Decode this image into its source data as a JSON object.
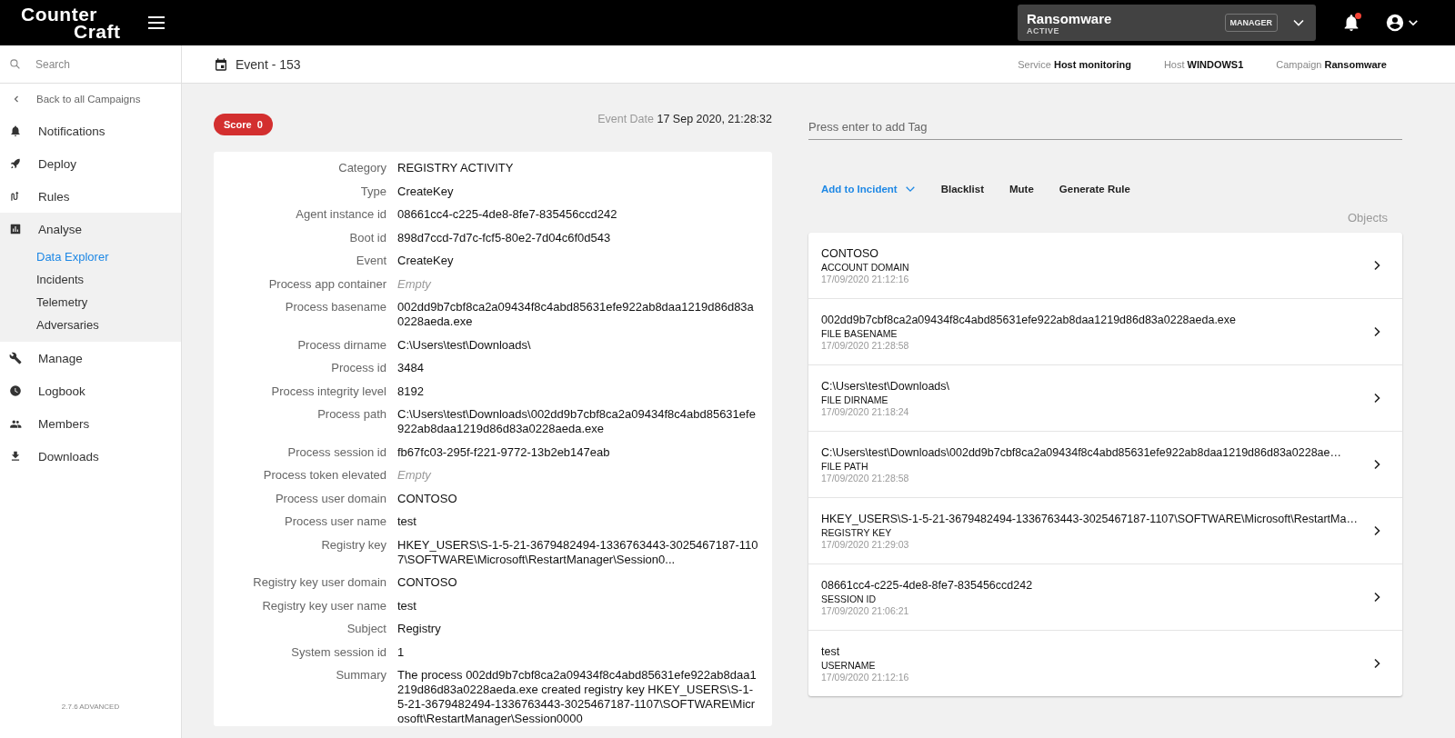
{
  "topbar": {
    "logo_line1": "Counter",
    "logo_line2": "Craft",
    "campaign": {
      "name": "Ransomware",
      "status": "ACTIVE",
      "role": "MANAGER"
    },
    "notifications_unread": true
  },
  "sidebar": {
    "search": {
      "placeholder": "Search"
    },
    "back": "Back to all Campaigns",
    "items": [
      {
        "label": "Notifications",
        "expanded": false
      },
      {
        "label": "Deploy",
        "expanded": false
      },
      {
        "label": "Rules",
        "expanded": false
      },
      {
        "label": "Analyse",
        "expanded": true,
        "children": [
          {
            "label": "Data Explorer",
            "selected": true
          },
          {
            "label": "Incidents",
            "selected": false
          },
          {
            "label": "Telemetry",
            "selected": false
          },
          {
            "label": "Adversaries",
            "selected": false
          }
        ]
      },
      {
        "label": "Manage",
        "expanded": false
      },
      {
        "label": "Logbook",
        "expanded": false
      },
      {
        "label": "Members",
        "expanded": false
      },
      {
        "label": "Downloads",
        "expanded": false
      }
    ],
    "version": "2.7.6 ADVANCED"
  },
  "header": {
    "title": "Event - 153",
    "meta": [
      {
        "label": "Service",
        "value": "Host monitoring"
      },
      {
        "label": "Host",
        "value": "WINDOWS1"
      },
      {
        "label": "Campaign",
        "value": "Ransomware"
      }
    ]
  },
  "event": {
    "score_label": "Score",
    "score": "0",
    "date_label": "Event Date",
    "date": "17 Sep 2020, 21:28:32",
    "fields": [
      {
        "label": "Category",
        "value": "REGISTRY ACTIVITY",
        "kind": "text"
      },
      {
        "label": "Type",
        "value": "CreateKey",
        "kind": "text"
      },
      {
        "label": "Agent instance id",
        "value": "08661cc4-c225-4de8-8fe7-835456ccd242",
        "kind": "text"
      },
      {
        "label": "Boot id",
        "value": "898d7ccd-7d7c-fcf5-80e2-7d04c6f0d543",
        "kind": "text"
      },
      {
        "label": "Event",
        "value": "CreateKey",
        "kind": "text"
      },
      {
        "label": "Process app container",
        "value": "Empty",
        "kind": "empty"
      },
      {
        "label": "Process basename",
        "value": "002dd9b7cbf8ca2a09434f8c4abd85631efe922ab8daa1219d86d83a0228aeda.exe",
        "kind": "text"
      },
      {
        "label": "Process dirname",
        "value": "C:\\Users\\test\\Downloads\\",
        "kind": "text"
      },
      {
        "label": "Process id",
        "value": "3484",
        "kind": "text"
      },
      {
        "label": "Process integrity level",
        "value": "8192",
        "kind": "text"
      },
      {
        "label": "Process path",
        "value": "C:\\Users\\test\\Downloads\\002dd9b7cbf8ca2a09434f8c4abd85631efe922ab8daa1219d86d83a0228aeda.exe",
        "kind": "text"
      },
      {
        "label": "Process session id",
        "value": "fb67fc03-295f-f221-9772-13b2eb147eab",
        "kind": "text"
      },
      {
        "label": "Process token elevated",
        "value": "Empty",
        "kind": "empty"
      },
      {
        "label": "Process user domain",
        "value": "CONTOSO",
        "kind": "text"
      },
      {
        "label": "Process user name",
        "value": "test",
        "kind": "text"
      },
      {
        "label": "Registry key",
        "value": "HKEY_USERS\\S-1-5-21-3679482494-1336763443-3025467187-1107\\SOFTWARE\\Microsoft\\RestartManager\\Session0...",
        "kind": "text"
      },
      {
        "label": "Registry key user domain",
        "value": "CONTOSO",
        "kind": "text"
      },
      {
        "label": "Registry key user name",
        "value": "test",
        "kind": "text"
      },
      {
        "label": "Subject",
        "value": "Registry",
        "kind": "text"
      },
      {
        "label": "System session id",
        "value": "1",
        "kind": "text"
      },
      {
        "label": "Summary",
        "value": "The process 002dd9b7cbf8ca2a09434f8c4abd85631efe922ab8daa1219d86d83a0228aeda.exe created registry key HKEY_USERS\\S-1-5-21-3679482494-1336763443-3025467187-1107\\SOFTWARE\\Microsoft\\RestartManager\\Session0000",
        "kind": "text"
      }
    ]
  },
  "tags": {
    "placeholder": "Press enter to add Tag"
  },
  "actions": [
    {
      "label": "Add to Incident",
      "kind": "dropdown"
    },
    {
      "label": "Blacklist",
      "kind": "plain"
    },
    {
      "label": "Mute",
      "kind": "plain"
    },
    {
      "label": "Generate Rule",
      "kind": "plain"
    }
  ],
  "objects": {
    "title": "Objects",
    "items": [
      {
        "value": "CONTOSO",
        "type": "ACCOUNT DOMAIN",
        "time": "17/09/2020 21:12:16"
      },
      {
        "value": "002dd9b7cbf8ca2a09434f8c4abd85631efe922ab8daa1219d86d83a0228aeda.exe",
        "type": "FILE BASENAME",
        "time": "17/09/2020 21:28:58"
      },
      {
        "value": "C:\\Users\\test\\Downloads\\",
        "type": "FILE DIRNAME",
        "time": "17/09/2020 21:18:24"
      },
      {
        "value": "C:\\Users\\test\\Downloads\\002dd9b7cbf8ca2a09434f8c4abd85631efe922ab8daa1219d86d83a0228ae…",
        "type": "FILE PATH",
        "time": "17/09/2020 21:28:58"
      },
      {
        "value": "HKEY_USERS\\S-1-5-21-3679482494-1336763443-3025467187-1107\\SOFTWARE\\Microsoft\\RestartMa…",
        "type": "REGISTRY KEY",
        "time": "17/09/2020 21:29:03"
      },
      {
        "value": "08661cc4-c225-4de8-8fe7-835456ccd242",
        "type": "SESSION ID",
        "time": "17/09/2020 21:06:21"
      },
      {
        "value": "test",
        "type": "USERNAME",
        "time": "17/09/2020 21:12:16"
      }
    ]
  }
}
